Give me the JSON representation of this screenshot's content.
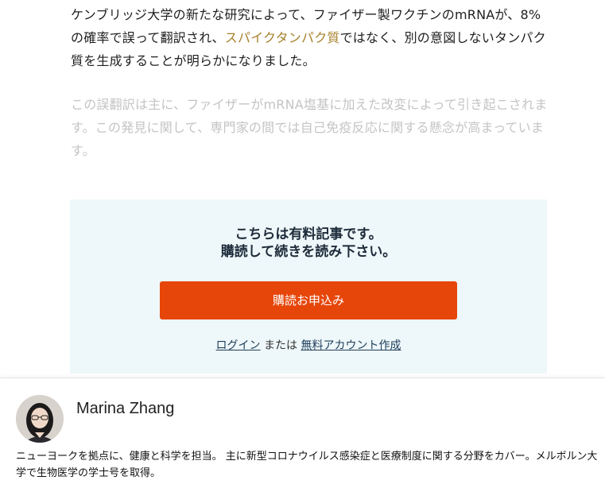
{
  "article": {
    "para1_part1": "ケンブリッジ大学の新たな研究によって、ファイザー製ワクチンのmRNAが、8%の確率で誤って翻訳され、",
    "para1_highlight": "スパイクタンパク質",
    "para1_part2": "ではなく、別の意図しないタンパク質を生成することが明らかになりました。",
    "para2": "この誤翻訳は主に、ファイザーがmRNA塩基に加えた改変によって引き起こされます。この発見に関して、専門家の間では自己免疫反応に関する懸念が高まっています。"
  },
  "paywall": {
    "title_line1": "こちらは有料記事です。",
    "title_line2": "購読して続きを読み下さい。",
    "subscribe_label": "購読お申込み",
    "login_label": "ログイン",
    "or_text": "または",
    "create_account_label": "無料アカウント作成"
  },
  "colors": {
    "highlight": "#a6812b",
    "subscribe_button": "#e6460a",
    "paywall_bg": "#eef7f9"
  },
  "author": {
    "name": "Marina Zhang",
    "bio": "ニューヨークを拠点に、健康と科学を担当。 主に新型コロナウイルス感染症と医療制度に関する分野をカバー。メルボルン大学で生物医学の学士号を取得。",
    "avatar_icon": "person-photo-icon"
  }
}
